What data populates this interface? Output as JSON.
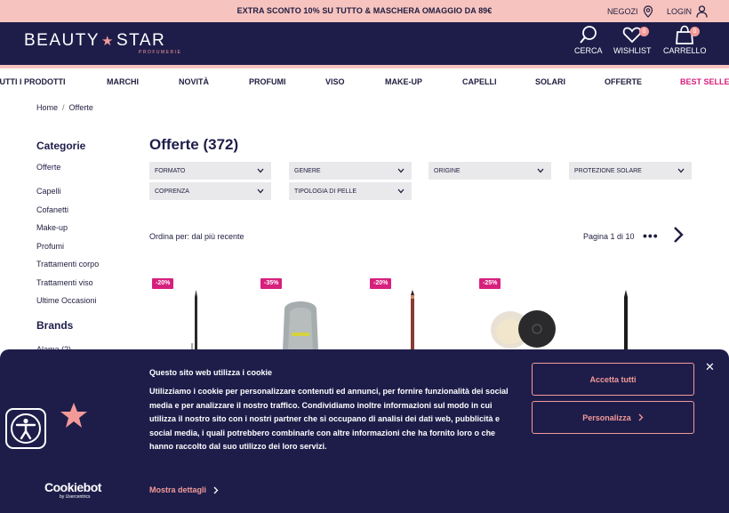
{
  "promo": {
    "text": "EXTRA SCONTO 10% SU TUTTO & MASCHERA OMAGGIO DA 89€",
    "negozi": "NEGOZI",
    "login": "LOGIN"
  },
  "header": {
    "logo_left": "BEAUTY",
    "logo_star": "★",
    "logo_right": "STAR",
    "logo_sub": "PROFUMERIE",
    "cerca": "CERCA",
    "wishlist": "WISHLIST",
    "wishlist_count": "0",
    "carrello": "CARRELLO",
    "cart_count": "0",
    "brand_color": "#1e1d4a",
    "accent_color": "#f39a98"
  },
  "nav": {
    "items": [
      "TUTTI I PRODOTTI",
      "MARCHI",
      "NOVITÀ",
      "PROFUMI",
      "VISO",
      "MAKE-UP",
      "CAPELLI",
      "SOLARI",
      "OFFERTE",
      "BEST SELLER"
    ]
  },
  "breadcrumb": {
    "home": "Home",
    "sep": "/",
    "current": "Offerte"
  },
  "sidebar": {
    "categories_title": "Categorie",
    "active": "Offerte",
    "items": [
      "Capelli",
      "Cofanetti",
      "Make-up",
      "Profumi",
      "Trattamenti corpo",
      "Trattamenti viso",
      "Ultime Occasioni"
    ],
    "brands_title": "Brands",
    "brand_partial": "Alama (2)"
  },
  "main": {
    "title": "Offerte (372)",
    "filters": [
      "FORMATO",
      "GENERE",
      "ORIGINE",
      "PROTEZIONE SOLARE",
      "COPRENZA",
      "TIPOLOGIA DI PELLE"
    ],
    "sort": "Ordina per: dal più recente",
    "pager": "Pagina 1 di 10",
    "dots": "•••",
    "discounts": [
      "-20%",
      "-35%",
      "-20%",
      "-25%"
    ],
    "discount_color": "#d7207d"
  },
  "cookie": {
    "title": "Questo sito web utilizza i cookie",
    "text": "Utilizziamo i cookie per personalizzare contenuti ed annunci, per fornire funzionalità dei social media e per analizzare il nostro traffico. Condividiamo inoltre informazioni sul modo in cui utilizza il nostro sito con i nostri partner che si occupano di analisi dei dati web, pubblicità e social media, i quali potrebbero combinarle con altre informazioni che ha fornito loro o che hanno raccolto dal suo utilizzo dei loro servizi.",
    "more": "Mostra dettagli",
    "accept": "Accetta tutti",
    "personalize": "Personalizza",
    "close": "✕",
    "brand": "Cookiebot",
    "brand_sub": "by Usercentrics"
  }
}
